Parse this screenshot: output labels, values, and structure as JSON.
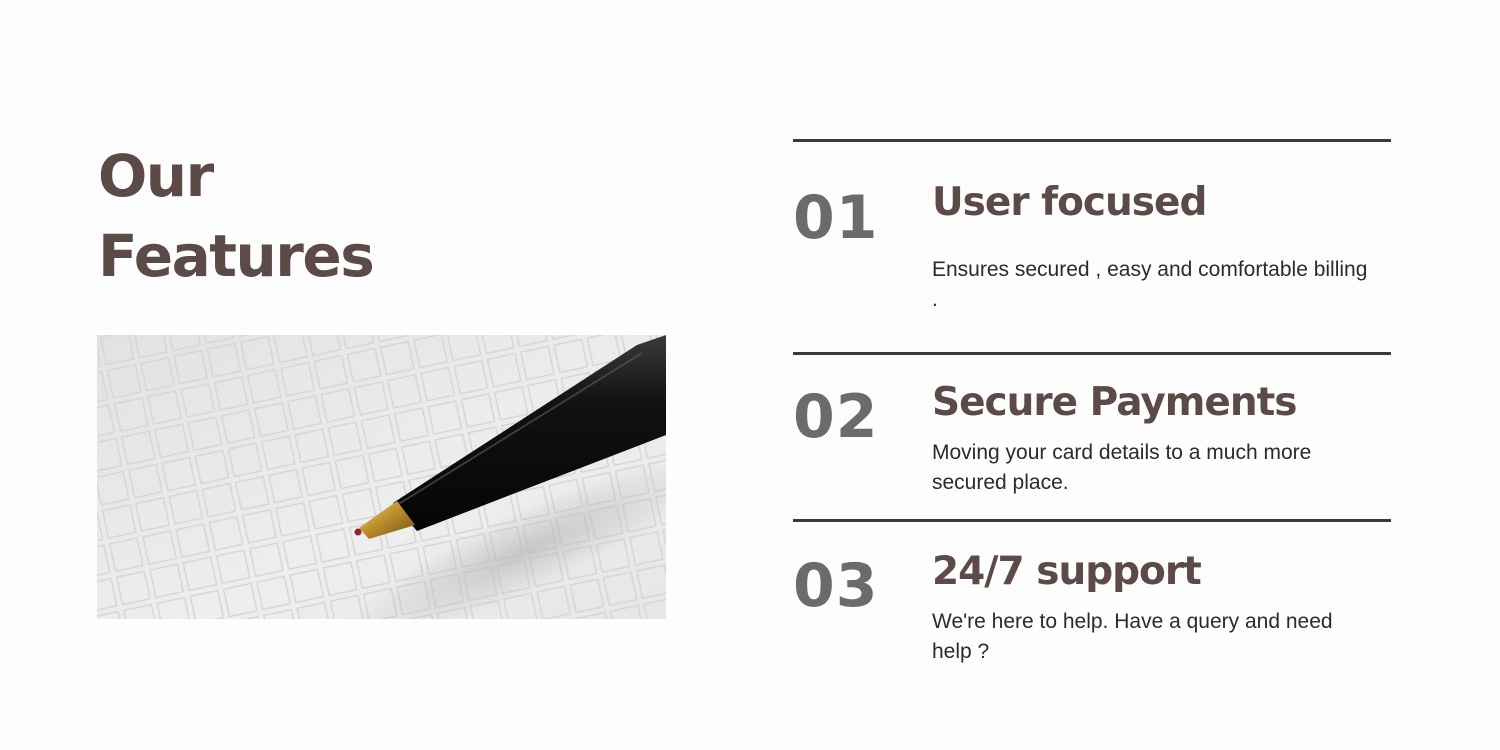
{
  "heading": {
    "line1": "Our",
    "line2": "Features"
  },
  "image": {
    "subject": "pen-tip-on-grid-paper"
  },
  "features": [
    {
      "number": "01",
      "title": "User focused",
      "description": "Ensures secured , easy and comfortable billing ."
    },
    {
      "number": "02",
      "title": "Secure Payments",
      "description": "Moving your card details to a much more secured place."
    },
    {
      "number": "03",
      "title": "24/7 support",
      "description": "We're here to help. Have a query and need help ?"
    }
  ],
  "colors": {
    "background": "#fdfdfd",
    "heading": "#5b4a47",
    "number": "#6b6b6b",
    "text": "#2b2b2b",
    "divider": "#3a3a3a"
  }
}
